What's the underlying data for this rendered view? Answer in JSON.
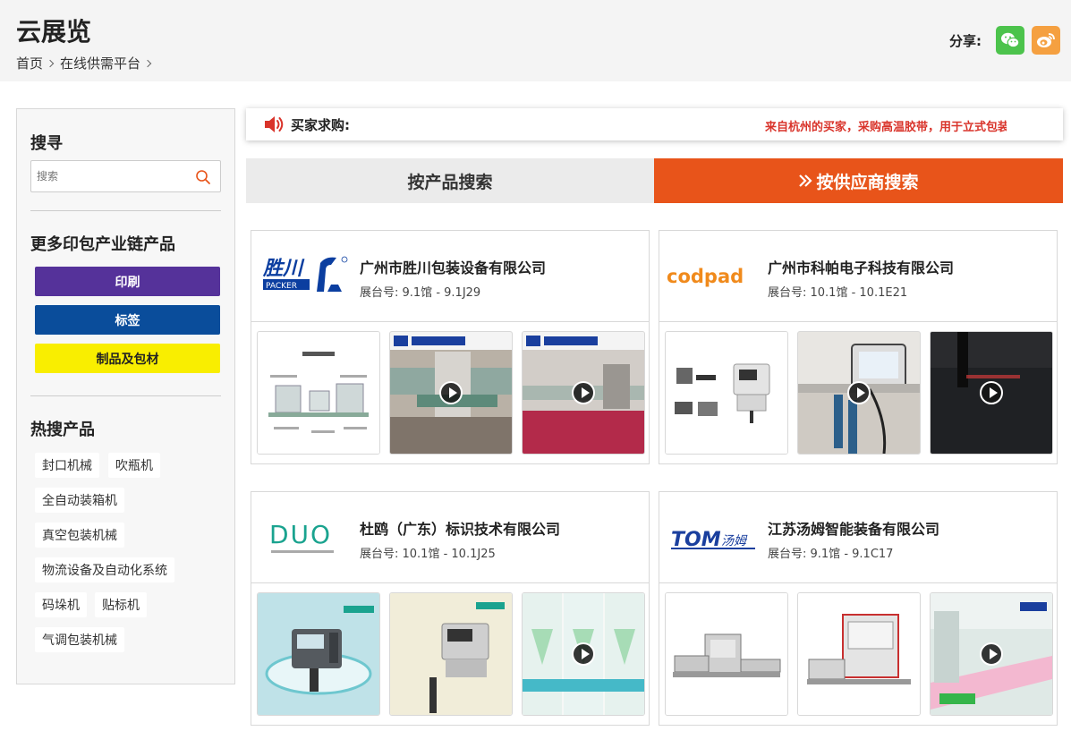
{
  "header": {
    "title": "云展览",
    "breadcrumb": [
      "首页",
      "在线供需平台"
    ],
    "share_label": "分享:"
  },
  "sidebar": {
    "search_title": "搜寻",
    "search_placeholder": "搜索",
    "more_title": "更多印包产业链产品",
    "categories": [
      {
        "label": "印刷",
        "bg": "#55329a",
        "fg": "#ffffff"
      },
      {
        "label": "标签",
        "bg": "#0a4d9b",
        "fg": "#ffffff"
      },
      {
        "label": "制品及包材",
        "bg": "#f9ee00",
        "fg": "#222222"
      }
    ],
    "hot_title": "热搜产品",
    "hot_tags": [
      "封口机械",
      "吹瓶机",
      "全自动装箱机",
      "真空包装机械",
      "物流设备及自动化系统",
      "码垛机",
      "贴标机",
      "气调包装机械"
    ]
  },
  "notice": {
    "label": "买家求购:",
    "text": "来自杭州的买家，采购高温胶带，用于立式包装"
  },
  "tabs": {
    "product": "按产品搜索",
    "supplier": "按供应商搜索"
  },
  "suppliers": [
    {
      "name": "广州市胜川包装设备有限公司",
      "booth": "展台号: 9.1馆 - 9.1J29",
      "logo_text": "胜川",
      "logo_sub": "PACKER"
    },
    {
      "name": "广州市科帕电子科技有限公司",
      "booth": "展台号: 10.1馆 - 10.1E21",
      "logo_text": "codpad"
    },
    {
      "name": "杜鸥（广东）标识技术有限公司",
      "booth": "展台号: 10.1馆 - 10.1J25",
      "logo_text": "DUO"
    },
    {
      "name": "江苏汤姆智能装备有限公司",
      "booth": "展台号: 9.1馆 - 9.1C17",
      "logo_text": "TOM",
      "logo_sub": "汤姆"
    }
  ],
  "colors": {
    "accent": "#e8541a",
    "notice_text": "#d9342b",
    "wechat": "#4cc34c",
    "weibo": "#f5a040"
  }
}
